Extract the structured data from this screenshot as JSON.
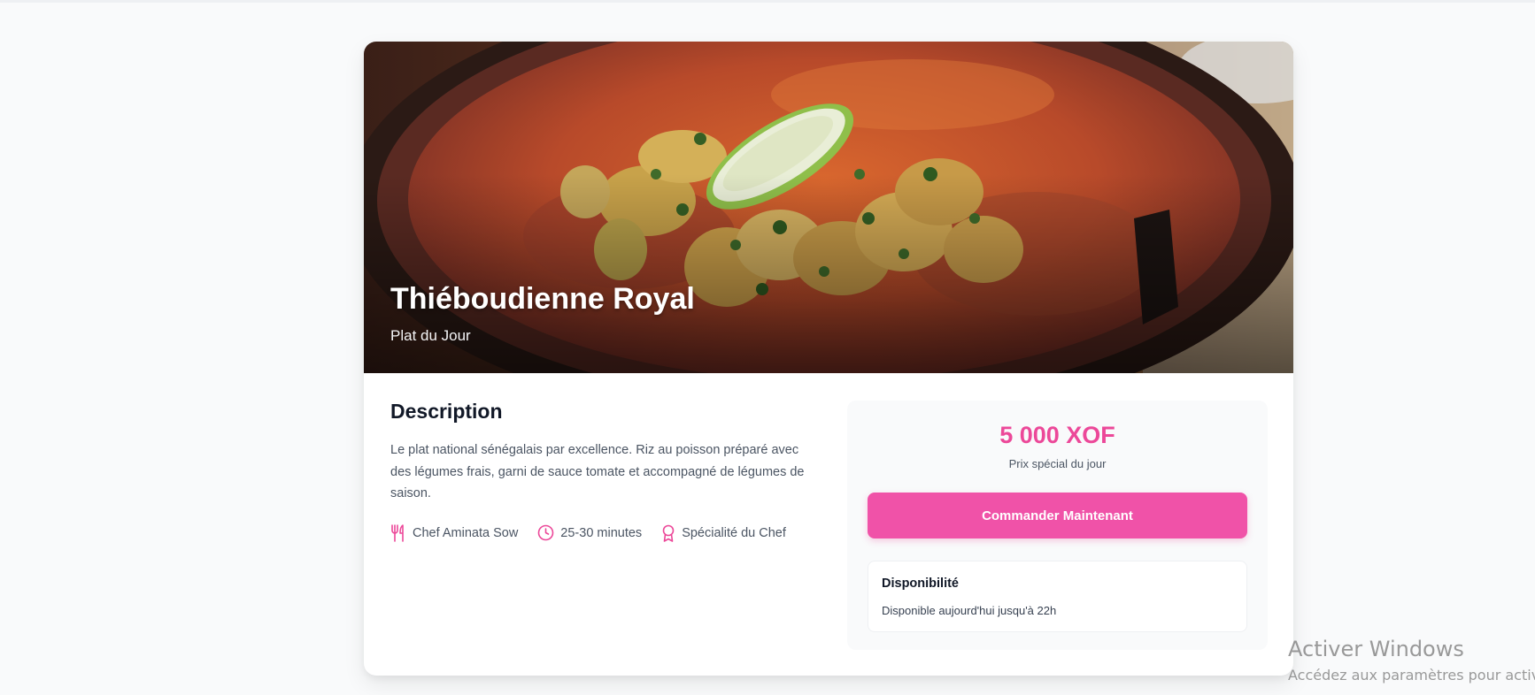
{
  "dish": {
    "title": "Thiéboudienne Royal",
    "subtitle": "Plat du Jour"
  },
  "description": {
    "heading": "Description",
    "text": "Le plat national sénégalais par excellence. Riz au poisson préparé avec des légumes frais, garni de sauce tomate et accompagné de légumes de saison."
  },
  "meta": {
    "chef": {
      "icon": "utensils-icon",
      "label": "Chef Aminata Sow"
    },
    "time": {
      "icon": "clock-icon",
      "label": "25-30 minutes"
    },
    "specialty": {
      "icon": "award-icon",
      "label": "Spécialité du Chef"
    }
  },
  "order": {
    "price": "5 000 XOF",
    "price_caption": "Prix spécial du jour",
    "button_label": "Commander Maintenant"
  },
  "availability": {
    "title": "Disponibilité",
    "text": "Disponible aujourd'hui jusqu'à 22h"
  },
  "watermark": {
    "title": "Activer Windows",
    "subtitle": "Accédez aux paramètres pour activ"
  },
  "colors": {
    "accent": "#ec4899",
    "button": "#f052a8",
    "background": "#f9fafb"
  }
}
